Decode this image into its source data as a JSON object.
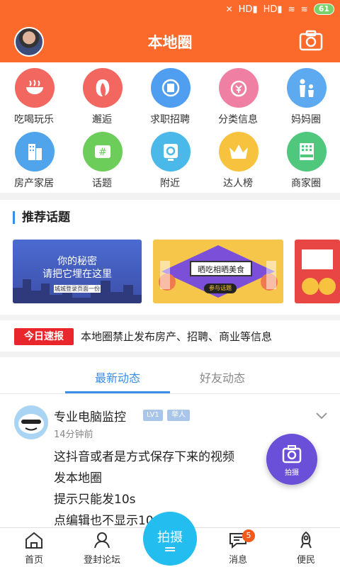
{
  "status_bar": {
    "battery": "61",
    "network_1": "HD",
    "network_2": "HD"
  },
  "header": {
    "title": "本地圈"
  },
  "grid": [
    {
      "label": "吃喝玩乐",
      "icon": "bowl-icon",
      "color": "#f2675f"
    },
    {
      "label": "邂逅",
      "icon": "lady-icon",
      "color": "#f2675f"
    },
    {
      "label": "求职招聘",
      "icon": "hire-icon",
      "color": "#4f9ef0"
    },
    {
      "label": "分类信息",
      "icon": "money-clock-icon",
      "color": "#f07fa4"
    },
    {
      "label": "妈妈圈",
      "icon": "family-icon",
      "color": "#5eaaf0"
    },
    {
      "label": "房产家居",
      "icon": "building-icon",
      "color": "#4fa4ec"
    },
    {
      "label": "话题",
      "icon": "hash-icon",
      "color": "#6dcd5a"
    },
    {
      "label": "附近",
      "icon": "location-icon",
      "color": "#4ab8e8"
    },
    {
      "label": "达人榜",
      "icon": "crown-icon",
      "color": "#f7c23e"
    },
    {
      "label": "商家圈",
      "icon": "hotel-icon",
      "color": "#4fc77c"
    }
  ],
  "recommended": {
    "title": "推荐话题",
    "banner1_line1": "你的秘密",
    "banner1_line2": "请把它埋在这里",
    "banner1_small": "城城登录页面一份",
    "banner2_text": "晒吃相晒美食",
    "banner2_button": "参与话题"
  },
  "ticker": {
    "badge": "今日速报",
    "text": "本地圈禁止发布房产、招聘、商业等信息"
  },
  "tabs": [
    {
      "label": "最新动态"
    },
    {
      "label": "好友动态"
    }
  ],
  "post": {
    "author": "专业电脑监控",
    "level": "LV1",
    "role": "举人",
    "time": "14分钟前",
    "lines": [
      "这抖音或者是方式保存下来的视频",
      "发本地圈",
      "提示只能发10s",
      "点编辑也不显示10"
    ]
  },
  "fab": {
    "label": "拍摄"
  },
  "bottom_nav": {
    "home": "首页",
    "forum": "登封论坛",
    "center": "拍摄",
    "messages": "消息",
    "messages_badge": "5",
    "service": "便民"
  }
}
